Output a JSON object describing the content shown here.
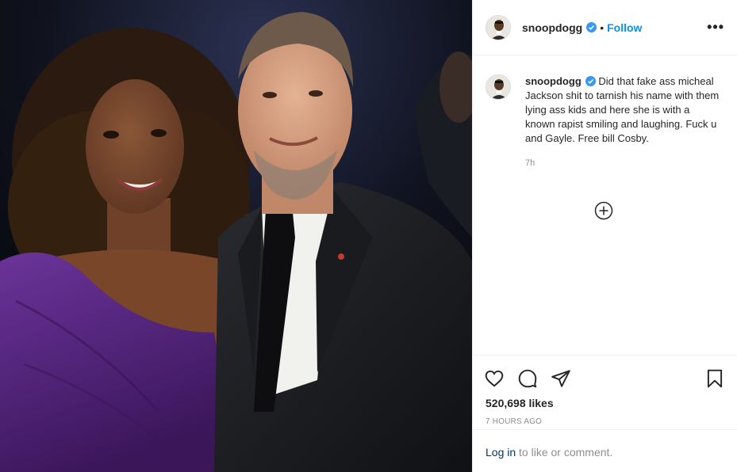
{
  "photo": {
    "alt_icon": "post-photo"
  },
  "header": {
    "username": "snoopdogg",
    "separator": "•",
    "follow_label": "Follow",
    "more_label": "•••",
    "verified_icon": "verified-badge-icon"
  },
  "caption": {
    "username": "snoopdogg",
    "text": "Did that fake ass micheal Jackson shit to tarnish his name with them lying ass kids and here she is with a known rapist smiling and laughing. Fuck u and Gayle. Free bill Cosby.",
    "time": "7h"
  },
  "actions": {
    "icons": [
      "heart-icon",
      "comment-icon",
      "share-icon",
      "bookmark-icon"
    ]
  },
  "likes": {
    "count_text": "520,698 likes"
  },
  "posted": {
    "ago": "7 HOURS AGO"
  },
  "login": {
    "link": "Log in",
    "rest": " to like or comment."
  },
  "colors": {
    "follow_blue": "#0095f6",
    "verified_blue": "#3897f0",
    "muted": "#8e8e8e",
    "text": "#262626",
    "dress_purple": "#5b2a86"
  }
}
